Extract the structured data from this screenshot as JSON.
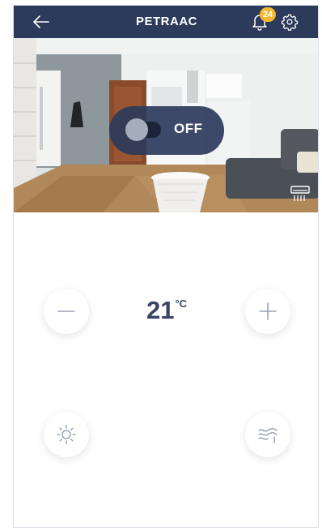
{
  "header": {
    "title": "PETRAAC",
    "notification_count": "24",
    "back_icon": "arrow-left-icon",
    "bell_icon": "bell-icon",
    "settings_icon": "gear-icon"
  },
  "power": {
    "state_label": "OFF",
    "is_on": false
  },
  "temperature": {
    "value": "21",
    "unit": "°C"
  },
  "controls": {
    "decrease_icon": "minus-icon",
    "increase_icon": "plus-icon",
    "mode_icon": "sun-icon",
    "fan_icon": "fan-speed-icon"
  },
  "colors": {
    "header_bg": "#2c3a5b",
    "badge": "#f5b82e",
    "temp_text": "#3a4563"
  }
}
